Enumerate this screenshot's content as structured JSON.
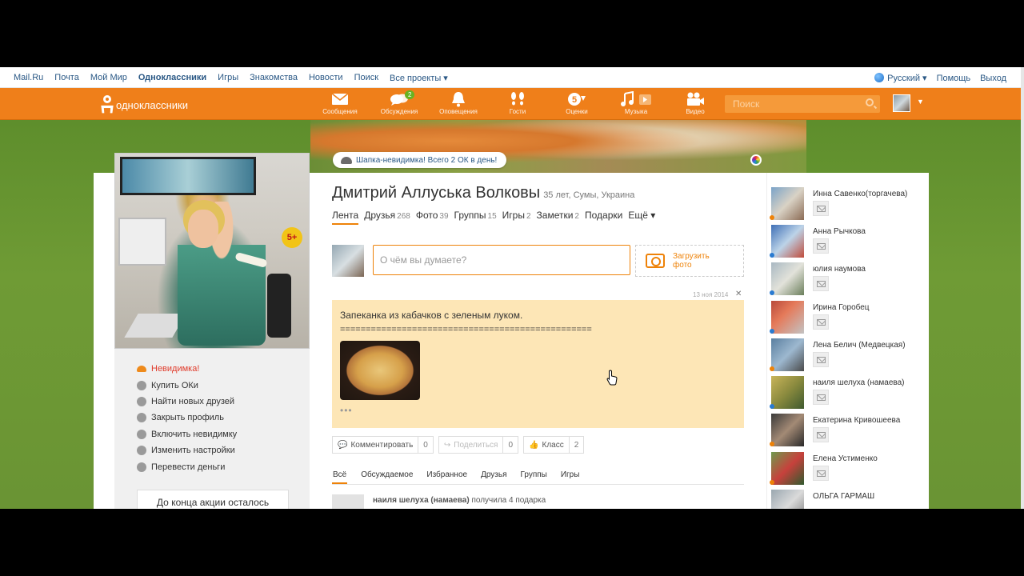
{
  "mailbar": {
    "links": [
      "Mail.Ru",
      "Почта",
      "Мой Мир",
      "Одноклассники",
      "Игры",
      "Знакомства",
      "Новости",
      "Поиск",
      "Все проекты ▾"
    ],
    "language": "Русский ▾",
    "help": "Помощь",
    "logout": "Выход"
  },
  "toolbar": {
    "logo": "одноклассники",
    "nav": [
      {
        "icon": "envelope-icon",
        "label": "Сообщения"
      },
      {
        "icon": "chat-bubbles-icon",
        "label": "Обсуждения",
        "badge": "2"
      },
      {
        "icon": "bell-icon",
        "label": "Оповещения"
      },
      {
        "icon": "footprints-icon",
        "label": "Гости"
      },
      {
        "icon": "rating-icon",
        "label": "Оценки"
      },
      {
        "icon": "music-icon",
        "label": "Музыка"
      },
      {
        "icon": "video-camera-icon",
        "label": "Видео"
      }
    ],
    "search_placeholder": "Поиск"
  },
  "promo": {
    "text": "Шапка-невидимка! Всего 2 ОК в день!"
  },
  "profile": {
    "name": "Дмитрий Аллуська Волковы",
    "meta": "35 лет, Сумы, Украина",
    "age_badge": "5+",
    "tabs": [
      {
        "label": "Лента",
        "count": ""
      },
      {
        "label": "Друзья",
        "count": "268"
      },
      {
        "label": "Фото",
        "count": "39"
      },
      {
        "label": "Группы",
        "count": "15"
      },
      {
        "label": "Игры",
        "count": "2"
      },
      {
        "label": "Заметки",
        "count": "2"
      },
      {
        "label": "Подарки",
        "count": ""
      },
      {
        "label": "Ещё ▾",
        "count": ""
      }
    ]
  },
  "sidebar_menu": [
    "Невидимка!",
    "Купить ОКи",
    "Найти новых друзей",
    "Закрыть профиль",
    "Включить невидимку",
    "Изменить настройки",
    "Перевести деньги"
  ],
  "sidebar_promo": "До конца акции осталось",
  "status": {
    "placeholder": "О чём вы думаете?",
    "upload_label_1": "Загрузить",
    "upload_label_2": "фото"
  },
  "post": {
    "date": "13 ноя 2014",
    "close": "✕",
    "title": "Запеканка из кабачков с зеленым луком.",
    "divider": "=================================================",
    "more": "•••"
  },
  "actions": {
    "comment": {
      "label": "Комментировать",
      "count": "0"
    },
    "share": {
      "label": "Поделиться",
      "count": "0"
    },
    "like": {
      "label": "Класс",
      "count": "2"
    }
  },
  "feed_tabs": [
    "Всё",
    "Обсуждаемое",
    "Избранное",
    "Друзья",
    "Группы",
    "Игры"
  ],
  "feed_item": {
    "author": "наиля шелуха (намаева)",
    "text": "получила 4 подарка"
  },
  "friends": [
    {
      "name": "Инна Савенко(торгачева)",
      "dot": "#ee8208"
    },
    {
      "name": "Анна Рычкова",
      "dot": "#2a7bd1"
    },
    {
      "name": "юлия наумова",
      "dot": "#2a7bd1"
    },
    {
      "name": "Ирина Горобец",
      "dot": "#2a7bd1"
    },
    {
      "name": "Лена Белич (Медвецкая)",
      "dot": "#ee8208"
    },
    {
      "name": "наиля шелуха (намаева)",
      "dot": "#2a7bd1"
    },
    {
      "name": "Екатерина Кривошеева",
      "dot": "#ee8208"
    },
    {
      "name": "Елена Устименко",
      "dot": "#ee8208"
    },
    {
      "name": "ОЛЬГА ГАРМАШ",
      "dot": ""
    }
  ]
}
